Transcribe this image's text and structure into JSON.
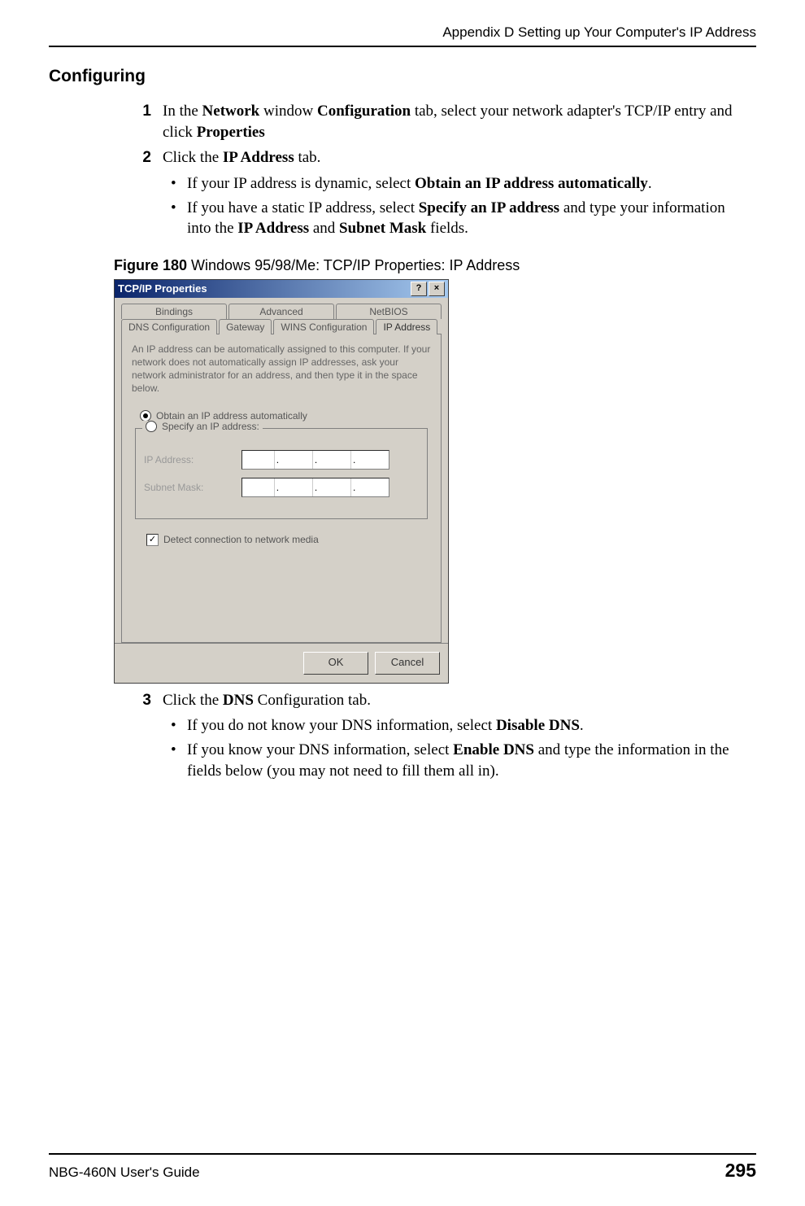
{
  "header": {
    "running_head": "Appendix D Setting up Your Computer's IP Address"
  },
  "section": {
    "heading": "Configuring"
  },
  "steps": {
    "s1_num": "1",
    "s1_pre": "In the ",
    "s1_b1": "Network",
    "s1_mid1": " window ",
    "s1_b2": "Configuration",
    "s1_mid2": " tab, select your network adapter's TCP/IP entry and click ",
    "s1_b3": "Properties",
    "s2_num": "2",
    "s2_pre": "Click the ",
    "s2_b1": "IP Address",
    "s2_post": " tab.",
    "b1_pre": "If your IP address is dynamic, select ",
    "b1_b": "Obtain an IP address automatically",
    "b1_post": ".",
    "b2_pre": "If you have a static IP address, select ",
    "b2_b1": "Specify an IP address",
    "b2_mid1": " and type your information into the ",
    "b2_b2": "IP Address",
    "b2_mid2": " and ",
    "b2_b3": "Subnet Mask",
    "b2_post": " fields.",
    "s3_num": "3",
    "s3_pre": "Click the ",
    "s3_b1": "DNS",
    "s3_post": " Configuration tab.",
    "b3_pre": "If you do not know your DNS information, select ",
    "b3_b": "Disable DNS",
    "b3_post": ".",
    "b4_pre": "If you know your DNS information, select ",
    "b4_b": "Enable DNS",
    "b4_post": " and type the information in the fields below (you may not need to fill them all in)."
  },
  "figure": {
    "label": "Figure 180",
    "caption": "   Windows 95/98/Me: TCP/IP Properties: IP Address"
  },
  "dialog": {
    "title": "TCP/IP Properties",
    "help_btn": "?",
    "close_btn": "×",
    "tabs_row1": [
      "Bindings",
      "Advanced",
      "NetBIOS"
    ],
    "tabs_row2": [
      "DNS Configuration",
      "Gateway",
      "WINS Configuration",
      "IP Address"
    ],
    "active_tab": "IP Address",
    "desc": "An IP address can be automatically assigned to this computer. If your network does not automatically assign IP addresses, ask your network administrator for an address, and then type it in the space below.",
    "radio_auto": "Obtain an IP address automatically",
    "radio_specify": "Specify an IP address:",
    "label_ip": "IP Address:",
    "label_mask": "Subnet Mask:",
    "check_detect": "Detect connection to network media",
    "btn_ok": "OK",
    "btn_cancel": "Cancel"
  },
  "footer": {
    "guide": "NBG-460N User's Guide",
    "page": "295"
  }
}
